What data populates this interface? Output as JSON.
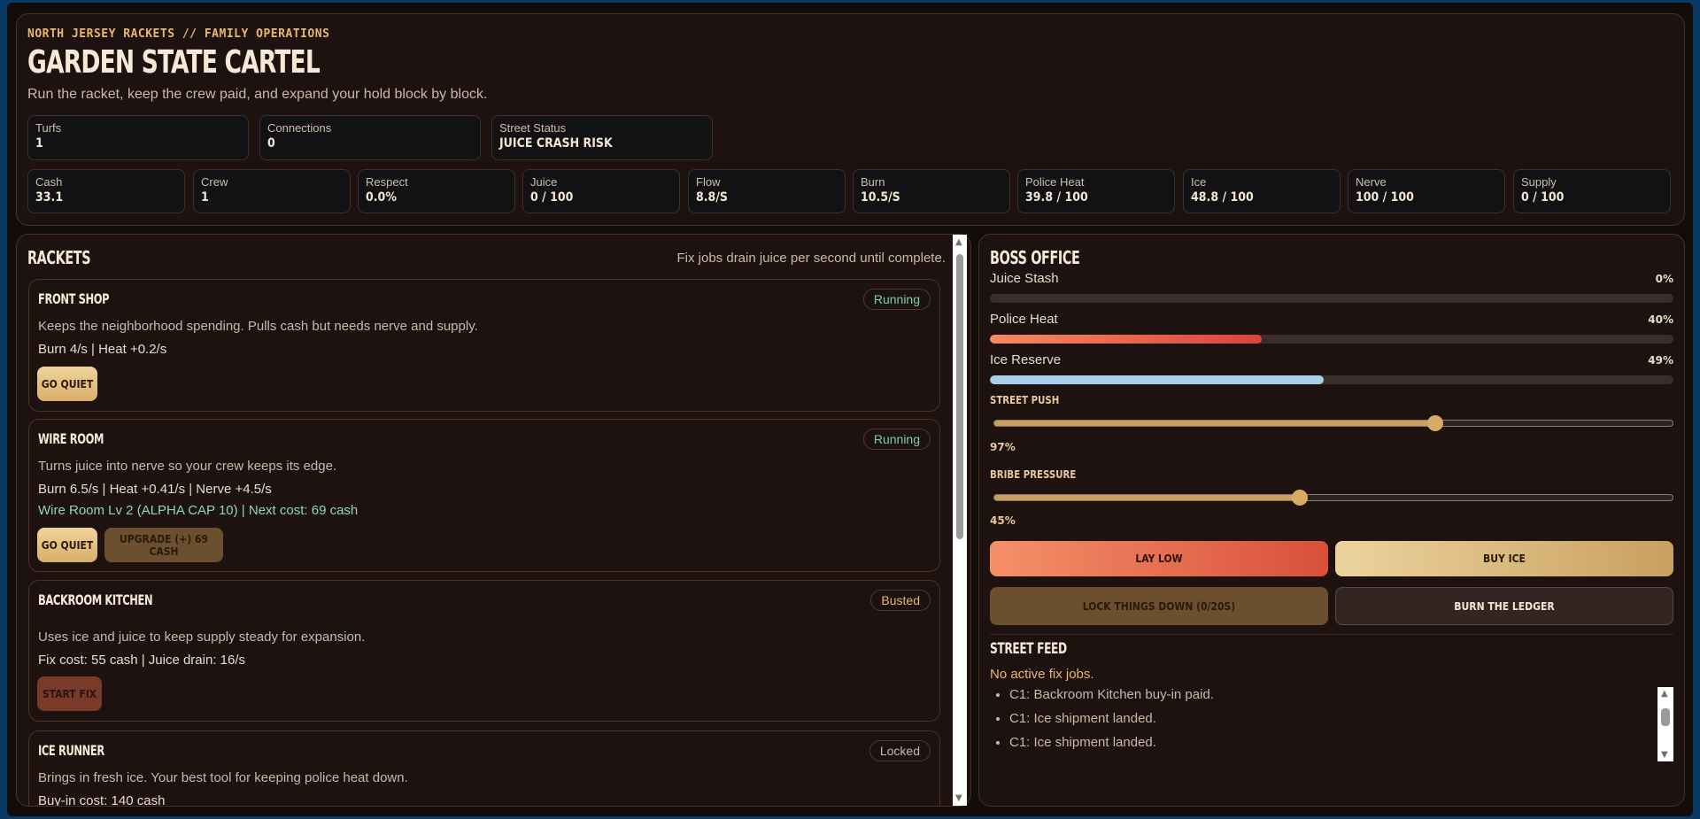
{
  "header": {
    "kicker": "NORTH JERSEY RACKETS // FAMILY OPERATIONS",
    "title": "GARDEN STATE CARTEL",
    "subtitle": "Run the racket, keep the crew paid, and expand your hold block by block.",
    "top_stats": [
      {
        "label": "Turfs",
        "value": "1"
      },
      {
        "label": "Connections",
        "value": "0"
      },
      {
        "label": "Street Status",
        "value": "JUICE CRASH RISK"
      }
    ],
    "stats": [
      {
        "label": "Cash",
        "value": "33.1"
      },
      {
        "label": "Crew",
        "value": "1"
      },
      {
        "label": "Respect",
        "value": "0.0%"
      },
      {
        "label": "Juice",
        "value": "0 / 100"
      },
      {
        "label": "Flow",
        "value": "8.8/S"
      },
      {
        "label": "Burn",
        "value": "10.5/S"
      },
      {
        "label": "Police Heat",
        "value": "39.8 / 100"
      },
      {
        "label": "Ice",
        "value": "48.8 / 100"
      },
      {
        "label": "Nerve",
        "value": "100 / 100"
      },
      {
        "label": "Supply",
        "value": "0 / 100"
      }
    ]
  },
  "rackets": {
    "title": "RACKETS",
    "hint": "Fix jobs drain juice per second until complete.",
    "items": [
      {
        "name": "FRONT SHOP",
        "status": "Running",
        "desc": "Keeps the neighborhood spending. Pulls cash but needs nerve and supply.",
        "line1": "Burn 4/s | Heat +0.2/s",
        "btn1": "GO QUIET"
      },
      {
        "name": "WIRE ROOM",
        "status": "Running",
        "desc": "Turns juice into nerve so your crew keeps its edge.",
        "line1": "Burn 6.5/s | Heat +0.41/s | Nerve +4.5/s",
        "line2": "Wire Room Lv 2 (ALPHA CAP 10) | Next cost: 69 cash",
        "btn1": "GO QUIET",
        "btn2": "UPGRADE (+) 69 CASH"
      },
      {
        "name": "BACKROOM KITCHEN",
        "status": "Busted",
        "desc": "Uses ice and juice to keep supply steady for expansion.",
        "line1": "Fix cost: 55 cash | Juice drain: 16/s",
        "btn1": "START FIX"
      },
      {
        "name": "ICE RUNNER",
        "status": "Locked",
        "desc": "Brings in fresh ice. Your best tool for keeping police heat down.",
        "line1": "Buy-in cost: 140 cash"
      }
    ]
  },
  "boss": {
    "title": "BOSS OFFICE",
    "meters": [
      {
        "label": "Juice Stash",
        "pct_label": "0%",
        "fraction": 0.0
      },
      {
        "label": "Police Heat",
        "pct_label": "40%",
        "fraction": 0.398
      },
      {
        "label": "Ice Reserve",
        "pct_label": "49%",
        "fraction": 0.488
      }
    ],
    "sliders": [
      {
        "label": "STREET PUSH",
        "value_label": "97%",
        "fraction": 0.65
      },
      {
        "label": "BRIBE PRESSURE",
        "value_label": "45%",
        "fraction": 0.45
      }
    ],
    "actions": {
      "lay_low": "LAY LOW",
      "buy_ice": "BUY ICE",
      "lock_down": "LOCK THINGS DOWN (0/20S)",
      "burn_ledger": "BURN THE LEDGER"
    },
    "feed": {
      "title": "STREET FEED",
      "empty": "No active fix jobs.",
      "items": [
        "C1: Backroom Kitchen buy-in paid.",
        "C1: Ice shipment landed.",
        "C1: Ice shipment landed."
      ]
    }
  },
  "colors": {
    "accent_gold": "#e7b86e",
    "running": "#7fcfa0",
    "busted": "#e7b86e",
    "locked": "#c9b9a6",
    "heat_gradient_start": "#f58a63",
    "heat_gradient_end": "#d9453a",
    "ice_fill": "#a9cfe8"
  },
  "icons": [
    "scroll-up-arrow-icon",
    "scroll-down-arrow-icon"
  ]
}
